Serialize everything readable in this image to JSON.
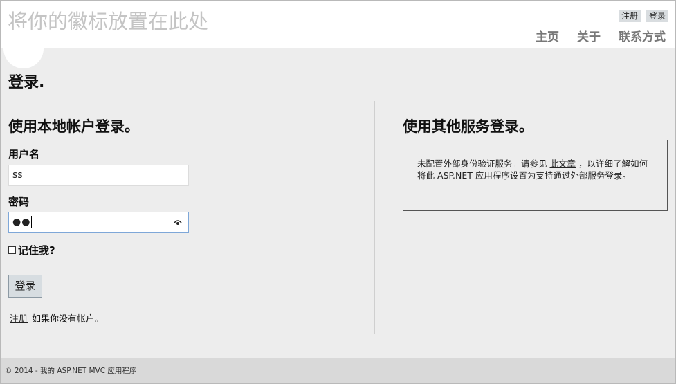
{
  "header": {
    "site_title": "将你的徽标放置在此处",
    "register_label": "注册",
    "login_label": "登录",
    "nav": {
      "home": "主页",
      "about": "关于",
      "contact": "联系方式"
    }
  },
  "main": {
    "page_title": "登录.",
    "local": {
      "title": "使用本地帐户登录。",
      "username_label": "用户名",
      "username_value": "ss",
      "password_label": "密码",
      "password_masked": "●●",
      "remember_label": "记住我?",
      "submit_label": "登录",
      "register_link": "注册",
      "register_suffix": "如果你没有帐户。"
    },
    "external": {
      "title": "使用其他服务登录。",
      "text_before": "未配置外部身份验证服务。请参见 ",
      "link": "此文章",
      "text_after": " ，以详细了解如何将此 ASP.NET 应用程序设置为支持通过外部服务登录。"
    }
  },
  "footer": {
    "text": "© 2014 - 我的 ASP.NET MVC 应用程序"
  },
  "icons": {
    "password_toggle": "eye-icon",
    "remember": "checkbox"
  }
}
